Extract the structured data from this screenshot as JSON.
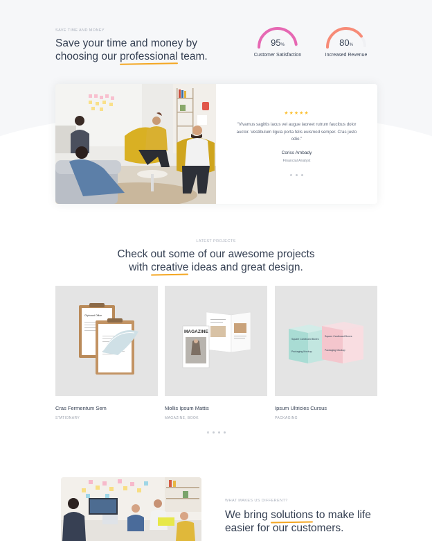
{
  "hero": {
    "overline": "SAVE TIME AND MONEY",
    "title_line1": "Save your time and money by",
    "title_pre": "choosing our ",
    "title_highlight": "professional",
    "title_post": " team."
  },
  "stats": [
    {
      "value": "95",
      "unit": "%",
      "label": "Customer Satisfaction",
      "fraction": 0.95,
      "color": "#e668b3"
    },
    {
      "value": "80",
      "unit": "%",
      "label": "Increased Revenue",
      "fraction": 0.8,
      "color": "#f78b77"
    }
  ],
  "testimonial": {
    "stars": "★★★★★",
    "quote": "\"Vivamus sagittis lacus vel augue laoreet rutrum faucibus dolor auctor. Vestibulum ligula porta felis euismod semper. Cras justo odio.\"",
    "name": "Coriss Ambady",
    "role": "Financial Analyst",
    "slide_count": 3,
    "active_slide": 0
  },
  "projects_section": {
    "overline": "LATEST PROJECTS",
    "title_line1": "Check out some of our awesome projects",
    "title_pre": "with ",
    "title_highlight": "creative",
    "title_post": " ideas and great design.",
    "items": [
      {
        "title": "Cras Fermentum Sem",
        "category": "STATIONARY",
        "image": "clipboard-mockup"
      },
      {
        "title": "Mollis Ipsum Mattis",
        "category": "MAGAZINE, BOOK",
        "image": "magazine-mockup"
      },
      {
        "title": "Ipsum Ultricies Cursus",
        "category": "PACKAGING",
        "image": "box-mockup"
      }
    ],
    "mockup_text": {
      "clipboard": "Clipboard Office",
      "magazine": "MAGAZINE",
      "box_a": "Square Cardboard Boxes",
      "box_b": "Packaging Mockup"
    },
    "slide_count": 4,
    "active_slide": 0
  },
  "different": {
    "overline": "WHAT MAKES US DIFFERENT?",
    "title_pre": "We bring ",
    "title_highlight": "solutions",
    "title_post": " to make life",
    "title_line2": "easier for our customers."
  }
}
